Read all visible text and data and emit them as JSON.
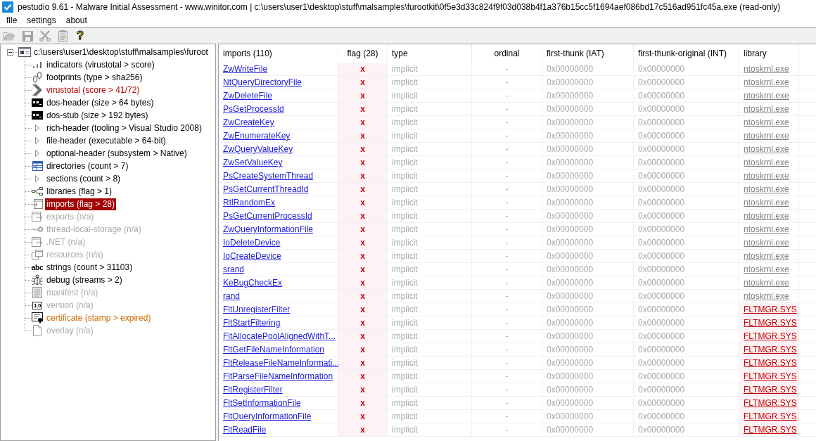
{
  "window": {
    "title": "pestudio 9.61 - Malware Initial Assessment - www.winitor.com | c:\\users\\user1\\desktop\\stuff\\malsamples\\furootkit\\0f5e3d33c824f9f03d038b4f1a376b15cc5f1694aef086bd17c516ad951fc45a.exe (read-only)"
  },
  "menu": [
    "file",
    "settings",
    "about"
  ],
  "toolbar": [
    {
      "disabled": true
    },
    {
      "disabled": true
    },
    {
      "disabled": true
    },
    {
      "disabled": true
    },
    {
      "glyph": "?",
      "disabled": false
    }
  ],
  "tree": {
    "label": "c:\\users\\user1\\desktop\\stuff\\malsamples\\furoot",
    "expanded": true,
    "children": [
      {
        "label": "indicators (virustotal > score)",
        "flagged": false,
        "warning": false,
        "disabled": false,
        "selected": false
      },
      {
        "label": "footprints (type > sha256)",
        "flagged": false,
        "warning": false,
        "disabled": false,
        "selected": false
      },
      {
        "label": "virustotal (score > 41/72)",
        "flagged": true,
        "warning": false,
        "disabled": false,
        "selected": false
      },
      {
        "label": "dos-header (size > 64 bytes)",
        "flagged": false,
        "warning": false,
        "disabled": false,
        "selected": false
      },
      {
        "label": "dos-stub (size > 192 bytes)",
        "flagged": false,
        "warning": false,
        "disabled": false,
        "selected": false
      },
      {
        "label": "rich-header (tooling > Visual Studio 2008)",
        "flagged": false,
        "warning": false,
        "disabled": false,
        "selected": false,
        "expanded": false
      },
      {
        "label": "file-header (executable > 64-bit)",
        "flagged": false,
        "warning": false,
        "disabled": false,
        "selected": false,
        "expanded": false
      },
      {
        "label": "optional-header (subsystem > Native)",
        "flagged": false,
        "warning": false,
        "disabled": false,
        "selected": false,
        "expanded": false
      },
      {
        "label": "directories (count > 7)",
        "flagged": false,
        "warning": false,
        "disabled": false,
        "selected": false
      },
      {
        "label": "sections (count > 8)",
        "flagged": false,
        "warning": false,
        "disabled": false,
        "selected": false,
        "expanded": false
      },
      {
        "label": "libraries (flag > 1)",
        "flagged": false,
        "warning": false,
        "disabled": false,
        "selected": false
      },
      {
        "label": "imports (flag > 28)",
        "flagged": true,
        "warning": false,
        "disabled": false,
        "selected": true
      },
      {
        "label": "exports (n/a)",
        "flagged": false,
        "warning": false,
        "disabled": true,
        "selected": false
      },
      {
        "label": "thread-local-storage (n/a)",
        "flagged": false,
        "warning": false,
        "disabled": true,
        "selected": false
      },
      {
        "label": ".NET (n/a)",
        "flagged": false,
        "warning": false,
        "disabled": true,
        "selected": false
      },
      {
        "label": "resources (n/a)",
        "flagged": false,
        "warning": false,
        "disabled": true,
        "selected": false
      },
      {
        "label": "strings (count > 31103)",
        "flagged": false,
        "warning": false,
        "disabled": false,
        "selected": false,
        "glyph": "abc"
      },
      {
        "label": "debug (streams > 2)",
        "flagged": false,
        "warning": false,
        "disabled": false,
        "selected": false
      },
      {
        "label": "manifest (n/a)",
        "flagged": false,
        "warning": false,
        "disabled": true,
        "selected": false
      },
      {
        "label": "version (n/a)",
        "flagged": false,
        "warning": false,
        "disabled": true,
        "selected": false,
        "glyph": "1.0"
      },
      {
        "label": "certificate (stamp > expired)",
        "flagged": false,
        "warning": true,
        "disabled": false,
        "selected": false
      },
      {
        "label": "overlay (n/a)",
        "flagged": false,
        "warning": false,
        "disabled": true,
        "selected": false
      }
    ]
  },
  "table": {
    "columns": [
      "imports (110)",
      "flag (28)",
      "type",
      "ordinal",
      "first-thunk (IAT)",
      "first-thunk-original (INT)",
      "library"
    ],
    "rows": [
      {
        "name": "ZwWriteFile",
        "flag": "x",
        "type": "implicit",
        "ordinal": "-",
        "first_thunk": "0x00000000",
        "first_thunk_original": "0x00000000",
        "library": "ntoskrnl.exe",
        "library_flagged": false
      },
      {
        "name": "NtQueryDirectoryFile",
        "flag": "x",
        "type": "implicit",
        "ordinal": "-",
        "first_thunk": "0x00000000",
        "first_thunk_original": "0x00000000",
        "library": "ntoskrnl.exe",
        "library_flagged": false
      },
      {
        "name": "ZwDeleteFile",
        "flag": "x",
        "type": "implicit",
        "ordinal": "-",
        "first_thunk": "0x00000000",
        "first_thunk_original": "0x00000000",
        "library": "ntoskrnl.exe",
        "library_flagged": false
      },
      {
        "name": "PsGetProcessId",
        "flag": "x",
        "type": "implicit",
        "ordinal": "-",
        "first_thunk": "0x00000000",
        "first_thunk_original": "0x00000000",
        "library": "ntoskrnl.exe",
        "library_flagged": false
      },
      {
        "name": "ZwCreateKey",
        "flag": "x",
        "type": "implicit",
        "ordinal": "-",
        "first_thunk": "0x00000000",
        "first_thunk_original": "0x00000000",
        "library": "ntoskrnl.exe",
        "library_flagged": false
      },
      {
        "name": "ZwEnumerateKey",
        "flag": "x",
        "type": "implicit",
        "ordinal": "-",
        "first_thunk": "0x00000000",
        "first_thunk_original": "0x00000000",
        "library": "ntoskrnl.exe",
        "library_flagged": false
      },
      {
        "name": "ZwQueryValueKey",
        "flag": "x",
        "type": "implicit",
        "ordinal": "-",
        "first_thunk": "0x00000000",
        "first_thunk_original": "0x00000000",
        "library": "ntoskrnl.exe",
        "library_flagged": false
      },
      {
        "name": "ZwSetValueKey",
        "flag": "x",
        "type": "implicit",
        "ordinal": "-",
        "first_thunk": "0x00000000",
        "first_thunk_original": "0x00000000",
        "library": "ntoskrnl.exe",
        "library_flagged": false
      },
      {
        "name": "PsCreateSystemThread",
        "flag": "x",
        "type": "implicit",
        "ordinal": "-",
        "first_thunk": "0x00000000",
        "first_thunk_original": "0x00000000",
        "library": "ntoskrnl.exe",
        "library_flagged": false
      },
      {
        "name": "PsGetCurrentThreadId",
        "flag": "x",
        "type": "implicit",
        "ordinal": "-",
        "first_thunk": "0x00000000",
        "first_thunk_original": "0x00000000",
        "library": "ntoskrnl.exe",
        "library_flagged": false
      },
      {
        "name": "RtlRandomEx",
        "flag": "x",
        "type": "implicit",
        "ordinal": "-",
        "first_thunk": "0x00000000",
        "first_thunk_original": "0x00000000",
        "library": "ntoskrnl.exe",
        "library_flagged": false
      },
      {
        "name": "PsGetCurrentProcessId",
        "flag": "x",
        "type": "implicit",
        "ordinal": "-",
        "first_thunk": "0x00000000",
        "first_thunk_original": "0x00000000",
        "library": "ntoskrnl.exe",
        "library_flagged": false
      },
      {
        "name": "ZwQueryInformationFile",
        "flag": "x",
        "type": "implicit",
        "ordinal": "-",
        "first_thunk": "0x00000000",
        "first_thunk_original": "0x00000000",
        "library": "ntoskrnl.exe",
        "library_flagged": false
      },
      {
        "name": "IoDeleteDevice",
        "flag": "x",
        "type": "implicit",
        "ordinal": "-",
        "first_thunk": "0x00000000",
        "first_thunk_original": "0x00000000",
        "library": "ntoskrnl.exe",
        "library_flagged": false
      },
      {
        "name": "IoCreateDevice",
        "flag": "x",
        "type": "implicit",
        "ordinal": "-",
        "first_thunk": "0x00000000",
        "first_thunk_original": "0x00000000",
        "library": "ntoskrnl.exe",
        "library_flagged": false
      },
      {
        "name": "srand",
        "flag": "x",
        "type": "implicit",
        "ordinal": "-",
        "first_thunk": "0x00000000",
        "first_thunk_original": "0x00000000",
        "library": "ntoskrnl.exe",
        "library_flagged": false
      },
      {
        "name": "KeBugCheckEx",
        "flag": "x",
        "type": "implicit",
        "ordinal": "-",
        "first_thunk": "0x00000000",
        "first_thunk_original": "0x00000000",
        "library": "ntoskrnl.exe",
        "library_flagged": false
      },
      {
        "name": "rand",
        "flag": "x",
        "type": "implicit",
        "ordinal": "-",
        "first_thunk": "0x00000000",
        "first_thunk_original": "0x00000000",
        "library": "ntoskrnl.exe",
        "library_flagged": false
      },
      {
        "name": "FltUnregisterFilter",
        "flag": "x",
        "type": "implicit",
        "ordinal": "-",
        "first_thunk": "0x00000000",
        "first_thunk_original": "0x00000000",
        "library": "FLTMGR.SYS",
        "library_flagged": true
      },
      {
        "name": "FltStartFiltering",
        "flag": "x",
        "type": "implicit",
        "ordinal": "-",
        "first_thunk": "0x00000000",
        "first_thunk_original": "0x00000000",
        "library": "FLTMGR.SYS",
        "library_flagged": true
      },
      {
        "name": "FltAllocatePoolAlignedWithT...",
        "flag": "x",
        "type": "implicit",
        "ordinal": "-",
        "first_thunk": "0x00000000",
        "first_thunk_original": "0x00000000",
        "library": "FLTMGR.SYS",
        "library_flagged": true
      },
      {
        "name": "FltGetFileNameInformation",
        "flag": "x",
        "type": "implicit",
        "ordinal": "-",
        "first_thunk": "0x00000000",
        "first_thunk_original": "0x00000000",
        "library": "FLTMGR.SYS",
        "library_flagged": true
      },
      {
        "name": "FltReleaseFileNameInformati...",
        "flag": "x",
        "type": "implicit",
        "ordinal": "-",
        "first_thunk": "0x00000000",
        "first_thunk_original": "0x00000000",
        "library": "FLTMGR.SYS",
        "library_flagged": true
      },
      {
        "name": "FltParseFileNameInformation",
        "flag": "x",
        "type": "implicit",
        "ordinal": "-",
        "first_thunk": "0x00000000",
        "first_thunk_original": "0x00000000",
        "library": "FLTMGR.SYS",
        "library_flagged": true
      },
      {
        "name": "FltRegisterFilter",
        "flag": "x",
        "type": "implicit",
        "ordinal": "-",
        "first_thunk": "0x00000000",
        "first_thunk_original": "0x00000000",
        "library": "FLTMGR.SYS",
        "library_flagged": true
      },
      {
        "name": "FltSetInformationFile",
        "flag": "x",
        "type": "implicit",
        "ordinal": "-",
        "first_thunk": "0x00000000",
        "first_thunk_original": "0x00000000",
        "library": "FLTMGR.SYS",
        "library_flagged": true
      },
      {
        "name": "FltQueryInformationFile",
        "flag": "x",
        "type": "implicit",
        "ordinal": "-",
        "first_thunk": "0x00000000",
        "first_thunk_original": "0x00000000",
        "library": "FLTMGR.SYS",
        "library_flagged": true
      },
      {
        "name": "FltReadFile",
        "flag": "x",
        "type": "implicit",
        "ordinal": "-",
        "first_thunk": "0x00000000",
        "first_thunk_original": "0x00000000",
        "library": "FLTMGR.SYS",
        "library_flagged": true
      }
    ]
  }
}
